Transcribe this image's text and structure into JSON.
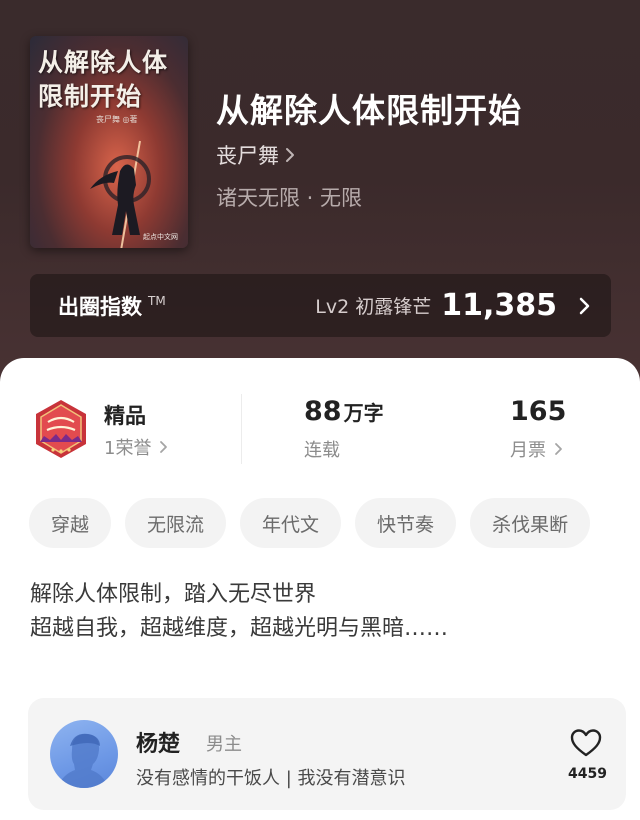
{
  "book": {
    "cover_title": "从解除人体限制开始",
    "cover_author": "丧尸舞 ◎著",
    "cover_publisher": "起点中文网",
    "title": "从解除人体限制开始",
    "author": "丧尸舞",
    "genre": "诸天无限 · 无限"
  },
  "circle_index": {
    "label": "出圈指数",
    "tm": "TM",
    "level": "Lv2 初露锋芒",
    "value": "11,385"
  },
  "stats": {
    "quality": {
      "label": "精品",
      "sub": "1荣誉"
    },
    "words": {
      "value": "88",
      "unit": "万字",
      "sub": "连载"
    },
    "votes": {
      "value": "165",
      "sub": "月票"
    }
  },
  "tags": [
    "穿越",
    "无限流",
    "年代文",
    "快节奏",
    "杀伐果断"
  ],
  "description": {
    "line1": "解除人体限制，踏入无尽世界",
    "line2": "超越自我，超越维度，超越光明与黑暗……"
  },
  "character": {
    "name": "杨楚",
    "role": "男主",
    "desc": "没有感情的干饭人 | 我没有潜意识",
    "likes": "4459"
  },
  "icons": {
    "chevron": "chevron-right-icon",
    "like": "heart-icon",
    "badge": "quality-badge-icon"
  },
  "colors": {
    "hero_bg": "#3b2a2b",
    "badge_red": "#c8333a",
    "avatar_blue": "#6d98e6"
  }
}
